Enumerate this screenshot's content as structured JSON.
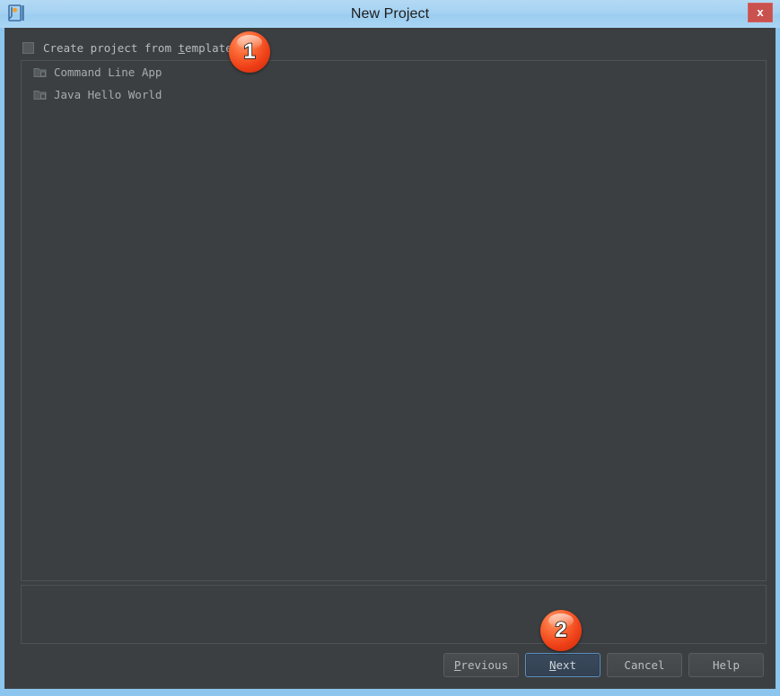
{
  "window": {
    "title": "New Project",
    "app_icon": "intellij-idea-icon",
    "close_label": "x",
    "frame_color": "#8cc5ee",
    "titlebar_color": "#a9d5f3",
    "body_color": "#3c3f41"
  },
  "template_option": {
    "label_prefix": "Create project from ",
    "mnemonic": "t",
    "label_suffix": "emplate",
    "checked": false,
    "checkbox_icon": "checkbox-unchecked-icon"
  },
  "template_list": {
    "items": [
      {
        "label": "Command Line App",
        "icon": "module-folder-icon",
        "selected": false
      },
      {
        "label": "Java Hello World",
        "icon": "module-folder-icon",
        "selected": false
      }
    ]
  },
  "description_panel": {
    "text": ""
  },
  "buttons": {
    "previous": {
      "mnemonic": "P",
      "rest": "revious",
      "default": false
    },
    "next": {
      "mnemonic": "N",
      "rest": "ext",
      "default": true
    },
    "cancel": {
      "label": "Cancel",
      "default": false
    },
    "help": {
      "label": "Help",
      "default": false
    }
  },
  "annotations": [
    {
      "number": "1",
      "target": "template-checkbox-row"
    },
    {
      "number": "2",
      "target": "next-button"
    }
  ]
}
